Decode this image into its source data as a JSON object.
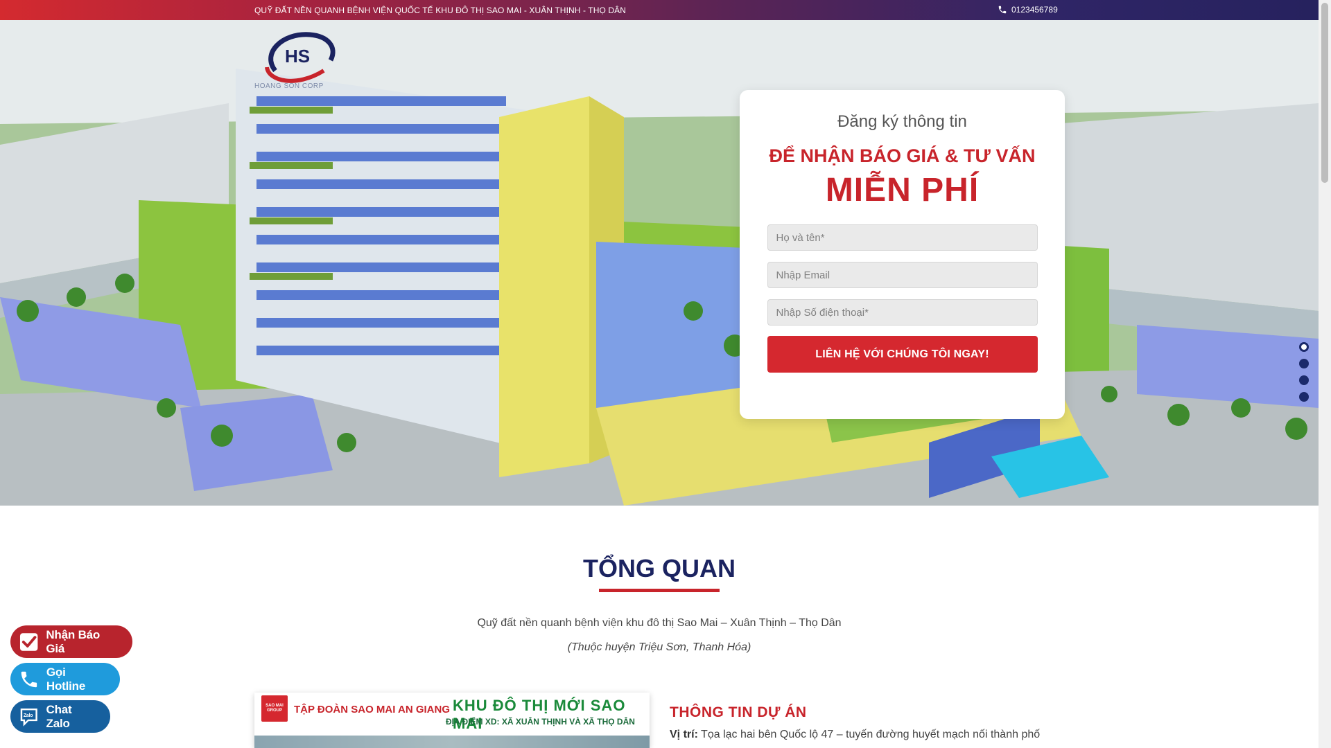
{
  "topbar": {
    "headline": "QUỸ ĐẤT NỀN QUANH BỆNH VIỆN QUỐC TẾ KHU ĐÔ THỊ SAO MAI - XUÂN THỊNH - THỌ DÂN",
    "phone": "0123456789",
    "phone_icon": "phone-icon"
  },
  "logo": {
    "initials": "HS",
    "name": "HOANG SON CORP"
  },
  "form": {
    "title": "Đăng ký thông tin",
    "subtitle": "ĐỂ NHẬN BÁO GIÁ & TƯ VẤN",
    "highlight": "MIỄN PHÍ",
    "name_placeholder": "Họ và tên*",
    "email_placeholder": "Nhập Email",
    "phone_placeholder": "Nhập Số điện thoại*",
    "submit_label": "LIÊN HỆ VỚI CHÚNG TÔI NGAY!"
  },
  "slider": {
    "active_index": 0,
    "count": 4
  },
  "overview": {
    "title": "TỔNG QUAN",
    "description": "Quỹ đất nền quanh bệnh viện khu đô thị Sao Mai – Xuân Thịnh – Thọ Dân",
    "note": "(Thuộc huyện Triệu Sơn, Thanh Hóa)"
  },
  "project_banner": {
    "group_logo": "SAO MAI GROUP",
    "group_name": "TẬP ĐOÀN SAO MAI AN GIANG",
    "headline": "KHU ĐÔ THỊ MỚI SAO MAI",
    "location": "ĐỊA ĐIỂM XD: XÃ XUÂN THỊNH VÀ XÃ THỌ DÂN"
  },
  "project_info": {
    "title": "THÔNG TIN DỰ ÁN",
    "location_label": "Vị trí:",
    "location_text": "Tọa lạc hai bên Quốc lộ 47 – tuyến đường huyết mạch nối thành phố"
  },
  "floating": {
    "quote_label": "Nhận Báo Giá",
    "hotline_label": "Gọi Hotline",
    "zalo_label": "Chat Zalo"
  },
  "colors": {
    "brand_red": "#c8242b",
    "navy": "#1b2360",
    "hotline_blue": "#1f9bdc",
    "zalo_blue": "#16609e"
  }
}
